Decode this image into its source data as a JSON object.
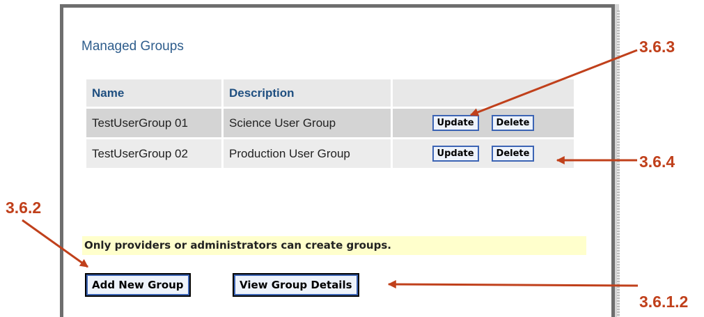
{
  "section_title": "Managed Groups",
  "table": {
    "headers": [
      "Name",
      "Description",
      ""
    ],
    "rows": [
      {
        "name": "TestUserGroup 01",
        "description": "Science User Group",
        "update_label": "Update",
        "delete_label": "Delete"
      },
      {
        "name": "TestUserGroup 02",
        "description": "Production User Group",
        "update_label": "Update",
        "delete_label": "Delete"
      }
    ]
  },
  "notice": "Only providers or administrators can create groups.",
  "buttons": {
    "add_new_group": "Add New Group",
    "view_group_details": "View Group Details"
  },
  "callouts": {
    "update": "3.6.3",
    "delete": "3.6.4",
    "add": "3.6.2",
    "view_details": "3.6.1.2"
  },
  "colors": {
    "callout": "#c0401b",
    "title": "#2e5d8c",
    "notice_bg": "#ffffcc",
    "button_border": "#3c64b4"
  }
}
